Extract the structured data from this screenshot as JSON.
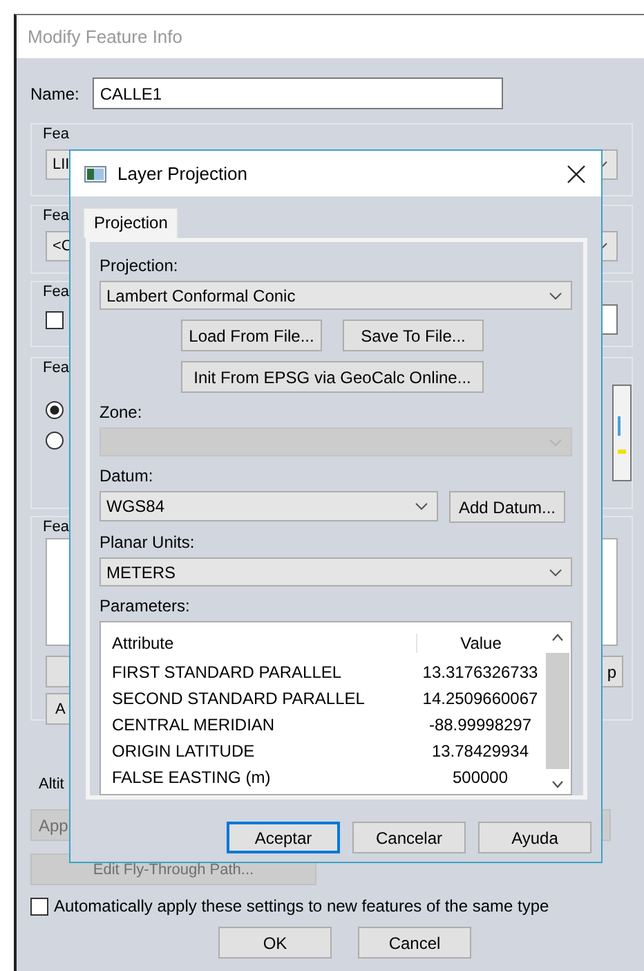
{
  "window": {
    "title": "Modify Feature Info"
  },
  "name_field": {
    "label": "Name:",
    "value": "CALLE1"
  },
  "groups": [
    {
      "label": "Fea",
      "kind": "combo",
      "value": "LII"
    },
    {
      "label": "Fea",
      "kind": "combo",
      "value": "<C"
    },
    {
      "label": "Fea",
      "kind": "checkbox",
      "checked": false
    },
    {
      "label": "Fea",
      "kind": "radios",
      "options": [
        {
          "selected": true
        },
        {
          "selected": false
        }
      ]
    },
    {
      "label": "Fea",
      "kind": "list",
      "buttons": [
        "p",
        "A"
      ]
    }
  ],
  "altitude_label": "Altit",
  "apply_button": {
    "label": "App",
    "disabled": true
  },
  "flythrough_button": {
    "label": "Edit Fly-Through Path...",
    "disabled": true
  },
  "auto_apply": {
    "label": "Automatically apply these settings to new features of the same type",
    "checked": false
  },
  "buttons": [
    "OK",
    "Cancel"
  ],
  "dialog": {
    "title": "Layer Projection",
    "tabs": [
      {
        "label": "Projection",
        "selected": true
      }
    ],
    "projection": {
      "label": "Projection:",
      "value": "Lambert Conformal Conic"
    },
    "file_buttons": [
      "Load From File...",
      "Save To File..."
    ],
    "epsg_button": "Init From EPSG via GeoCalc Online...",
    "zone": {
      "label": "Zone:",
      "disabled": true
    },
    "datum": {
      "label": "Datum:",
      "value": "WGS84",
      "button": "Add Datum..."
    },
    "planar_units": {
      "label": "Planar Units:",
      "value": "METERS"
    },
    "parameters": {
      "label": "Parameters:",
      "columns": [
        "Attribute",
        "Value"
      ],
      "rows": [
        {
          "attribute": "FIRST STANDARD PARALLEL",
          "value": "13.3176326733"
        },
        {
          "attribute": "SECOND STANDARD PARALLEL",
          "value": "14.2509660067"
        },
        {
          "attribute": "CENTRAL MERIDIAN",
          "value": "-88.99998297"
        },
        {
          "attribute": "ORIGIN LATITUDE",
          "value": "13.78429934"
        },
        {
          "attribute": "FALSE EASTING (m)",
          "value": "500000"
        }
      ]
    },
    "buttons": [
      {
        "label": "Aceptar",
        "default": true
      },
      {
        "label": "Cancelar",
        "default": false
      },
      {
        "label": "Ayuda",
        "default": false
      }
    ]
  }
}
